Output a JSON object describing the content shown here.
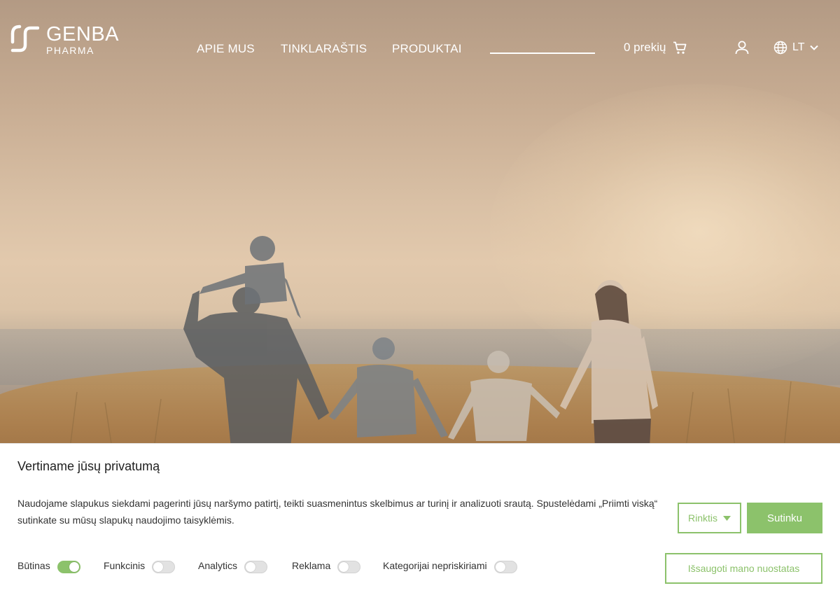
{
  "brand": {
    "name": "GENBA",
    "sub": "PHARMA"
  },
  "nav": {
    "items": [
      {
        "label": "APIE MUS"
      },
      {
        "label": "TINKLARAŠTIS"
      },
      {
        "label": "PRODUKTAI"
      }
    ],
    "search_placeholder": ""
  },
  "cart": {
    "label": "0 prekių"
  },
  "language": {
    "current": "LT"
  },
  "cookie": {
    "title": "Vertiname jūsų privatumą",
    "text": "Naudojame slapukus siekdami pagerinti jūsų naršymo patirtį, teikti suasmenintus skelbimus ar turinį ir analizuoti srautą. Spustelėdami „Priimti viską“ sutinkate su mūsų slapukų naudojimo taisyklėmis.",
    "customize_label": "Rinktis",
    "accept_label": "Sutinku",
    "save_label": "Išsaugoti mano nuostatas",
    "categories": [
      {
        "label": "Būtinas",
        "enabled": true
      },
      {
        "label": "Funkcinis",
        "enabled": false
      },
      {
        "label": "Analytics",
        "enabled": false
      },
      {
        "label": "Reklama",
        "enabled": false
      },
      {
        "label": "Kategorijai nepriskiriami",
        "enabled": false
      }
    ]
  },
  "colors": {
    "accent": "#8cc26b",
    "header_text": "#ffffff"
  },
  "icons": [
    "genba-logo-icon",
    "cart-icon",
    "user-icon",
    "globe-icon",
    "chevron-down-icon",
    "caret-down-icon"
  ]
}
